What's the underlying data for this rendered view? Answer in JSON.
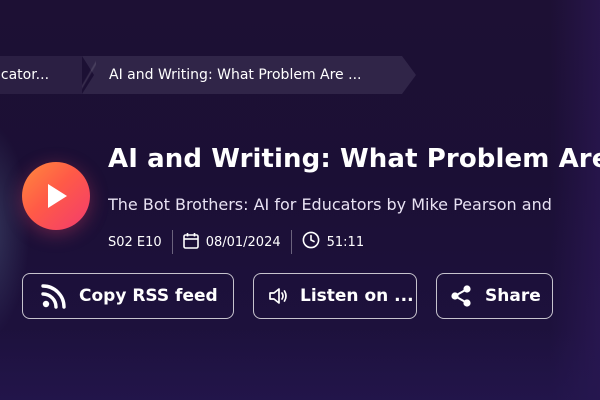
{
  "breadcrumb": {
    "items": [
      {
        "label": "ucator..."
      },
      {
        "label": "AI and Writing: What Problem Are ..."
      }
    ]
  },
  "episode": {
    "title": "AI and Writing: What Problem Are W",
    "subtitle": "The Bot Brothers: AI for Educators by Mike Pearson and",
    "season_episode": "S02 E10",
    "date": "08/01/2024",
    "duration": "51:11"
  },
  "actions": {
    "rss_label": "Copy RSS feed",
    "listen_label": "Listen on ...",
    "share_label": "Share"
  },
  "icons": {
    "play": "play-icon",
    "calendar": "calendar-icon",
    "clock": "clock-icon",
    "rss": "rss-icon",
    "speaker": "speaker-icon",
    "share": "share-icon"
  },
  "colors": {
    "background": "#1b0f35",
    "play_gradient_start": "#ff8a3d",
    "play_gradient_end": "#f23b6e",
    "text": "#ffffff"
  }
}
